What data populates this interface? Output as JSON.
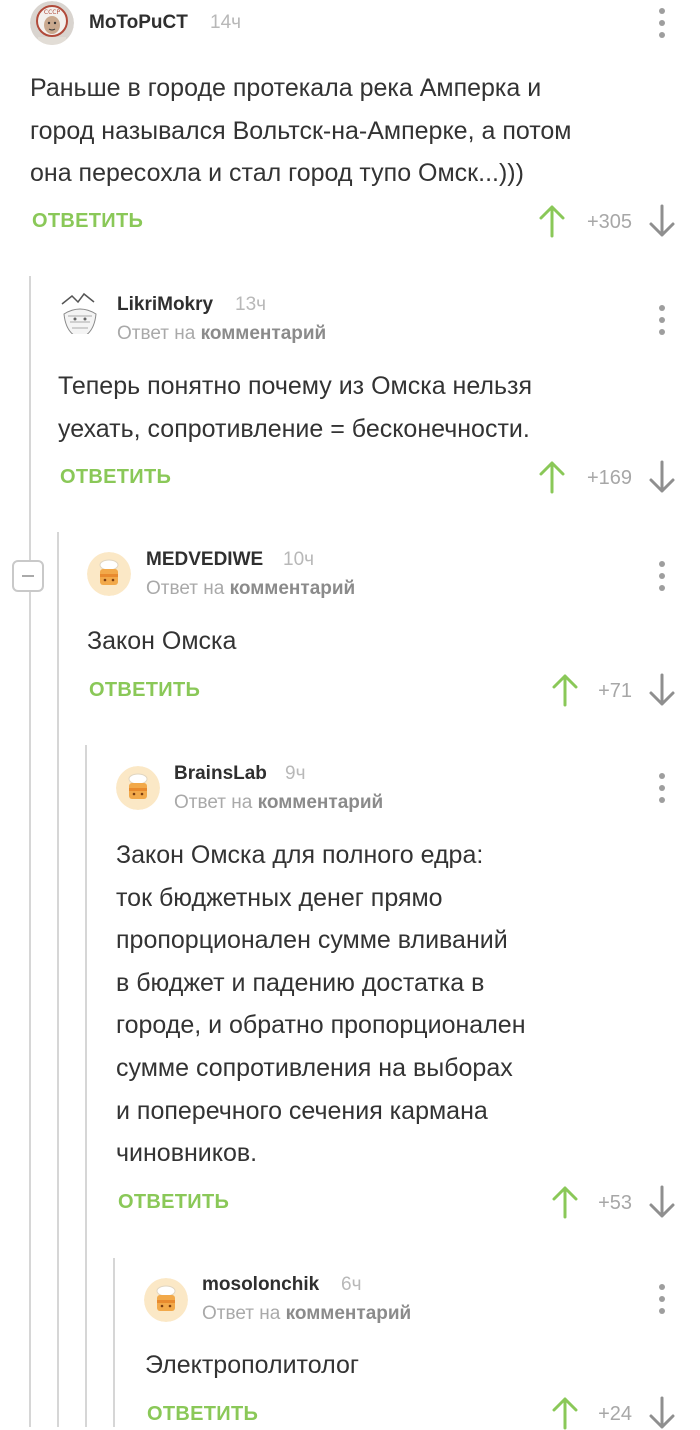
{
  "colors": {
    "accent_green": "#8ac858",
    "thread_line": "#d6d6d6",
    "muted_text": "#a9a9a9"
  },
  "comments": [
    {
      "author": "MoToPuCT",
      "time": "14ч",
      "avatar_icon": "astronaut-avatar",
      "reply_to_prefix": "",
      "reply_to_link": "",
      "text_lines": [
        "Раньше в городе протекала река Амперка и",
        "город назывался Вольтск-на-Амперке, а потом",
        "она пересохла и стал город тупо Омск...)))"
      ],
      "reply_label": "ОТВЕТИТЬ",
      "rating": "+305"
    },
    {
      "author": "LikriMokry",
      "time": "13ч",
      "avatar_icon": "sketch-avatar",
      "reply_to_prefix": "Ответ на",
      "reply_to_link": "комментарий",
      "text_lines": [
        "Теперь понятно почему из Омска нельзя",
        "уехать, сопротивление = бесконечности."
      ],
      "reply_label": "ОТВЕТИТЬ",
      "rating": "+169"
    },
    {
      "author": "MEDVEDIWE",
      "time": "10ч",
      "avatar_icon": "default-cake-avatar",
      "reply_to_prefix": "Ответ на",
      "reply_to_link": "комментарий",
      "text_lines": [
        "Закон Омска"
      ],
      "reply_label": "ОТВЕТИТЬ",
      "rating": "+71"
    },
    {
      "author": "BrainsLab",
      "time": "9ч",
      "avatar_icon": "default-cake-avatar",
      "reply_to_prefix": "Ответ на",
      "reply_to_link": "комментарий",
      "text_lines": [
        "Закон Омска для полного едра:",
        "ток бюджетных денег прямо",
        "пропорционален сумме вливаний",
        "в бюджет и падению достатка в",
        "городе, и обратно пропорционален",
        "сумме сопротивления на выборах",
        "и поперечного сечения кармана",
        "чиновников."
      ],
      "reply_label": "ОТВЕТИТЬ",
      "rating": "+53"
    },
    {
      "author": "mosolonchik",
      "time": "6ч",
      "avatar_icon": "default-cake-avatar",
      "reply_to_prefix": "Ответ на",
      "reply_to_link": "комментарий",
      "text_lines": [
        "Электрополитолог"
      ],
      "reply_label": "ОТВЕТИТЬ",
      "rating": "+24"
    }
  ]
}
